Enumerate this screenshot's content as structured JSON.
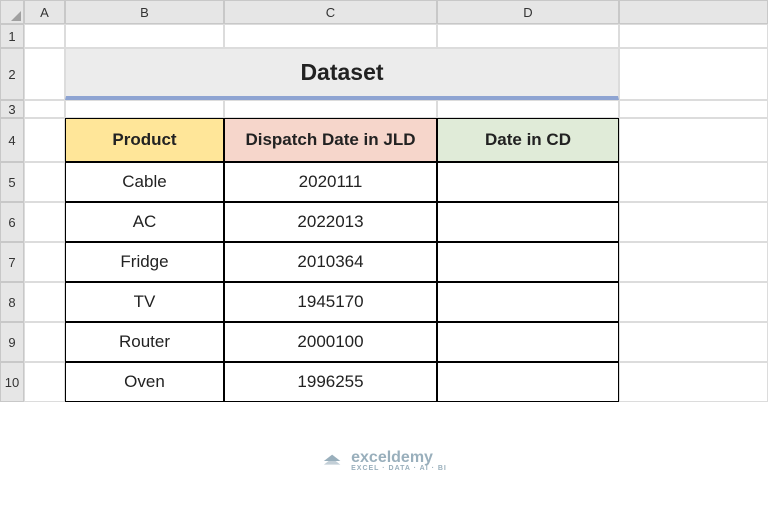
{
  "columns": [
    "A",
    "B",
    "C",
    "D"
  ],
  "rows": [
    "1",
    "2",
    "3",
    "4",
    "5",
    "6",
    "7",
    "8",
    "9",
    "10"
  ],
  "title": "Dataset",
  "table": {
    "headers": {
      "product": "Product",
      "dispatch": "Dispatch Date in JLD",
      "datecd": "Date in CD"
    },
    "data": [
      {
        "product": "Cable",
        "dispatch": "2020111",
        "datecd": ""
      },
      {
        "product": "AC",
        "dispatch": "2022013",
        "datecd": ""
      },
      {
        "product": "Fridge",
        "dispatch": "2010364",
        "datecd": ""
      },
      {
        "product": "TV",
        "dispatch": "1945170",
        "datecd": ""
      },
      {
        "product": "Router",
        "dispatch": "2000100",
        "datecd": ""
      },
      {
        "product": "Oven",
        "dispatch": "1996255",
        "datecd": ""
      }
    ]
  },
  "watermark": {
    "name": "exceldemy",
    "subtitle": "EXCEL · DATA · AI · BI"
  }
}
